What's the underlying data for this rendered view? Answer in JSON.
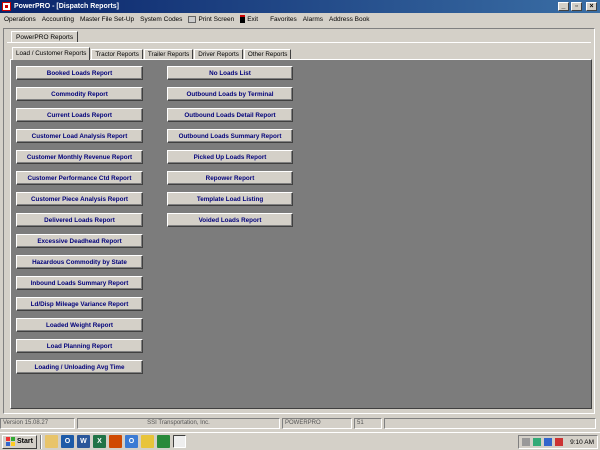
{
  "window": {
    "title": "PowerPRO - [Dispatch Reports]"
  },
  "menu": {
    "items": [
      "Operations",
      "Accounting",
      "Master File Set-Up",
      "System Codes"
    ],
    "print_screen": "Print Screen",
    "exit": "Exit",
    "right_items": [
      "Favorites",
      "Alarms",
      "Address Book"
    ]
  },
  "doc_tab": "PowerPRO Reports",
  "report_tabs": [
    "Load / Customer Reports",
    "Tractor Reports",
    "Trailer Reports",
    "Driver Reports",
    "Other Reports"
  ],
  "active_tab": "Load / Customer Reports",
  "column1": [
    "Booked Loads Report",
    "Commodity Report",
    "Current Loads Report",
    "Customer Load Analysis Report",
    "Customer Monthly Revenue Report",
    "Customer Performance Ctd Report",
    "Customer Piece Analysis Report",
    "Delivered Loads Report",
    "Excessive Deadhead Report",
    "Hazardous Commodity by State",
    "Inbound Loads Summary Report",
    "Ld/Disp Mileage Variance Report",
    "Loaded Weight Report",
    "Load Planning Report",
    "Loading / Unloading Avg Time"
  ],
  "column2": [
    "No Loads List",
    "Outbound Loads by Terminal",
    "Outbound Loads Detail Report",
    "Outbound Loads Summary Report",
    "Picked Up Loads Report",
    "Repower Report",
    "Template Load Listing",
    "Voided Loads Report"
  ],
  "status": {
    "version": "Version 15.08.27",
    "company": "SSI Transportation, Inc.",
    "app": "POWERPRO",
    "code": "51"
  },
  "taskbar": {
    "start": "Start",
    "clock": "9:10 AM"
  },
  "colors": {
    "title_bar": "#0a246a",
    "panel_bg": "#7c7c7c",
    "button_text": "#00007a"
  }
}
